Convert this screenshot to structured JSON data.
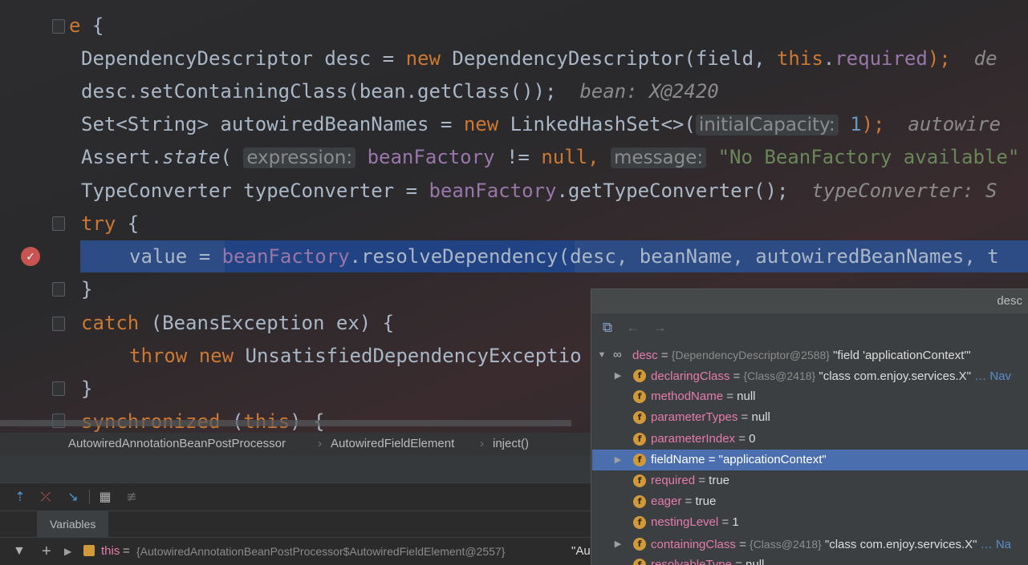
{
  "editor": {
    "lines": [
      {
        "segs": [
          {
            "t": "e",
            "c": "kw"
          },
          {
            "t": " {"
          }
        ]
      },
      {
        "segs": [
          {
            "t": "DependencyDescriptor desc = "
          },
          {
            "t": "new",
            "c": "kw"
          },
          {
            "t": " DependencyDescriptor(field, "
          },
          {
            "t": "this",
            "c": "kw"
          },
          {
            "t": "."
          },
          {
            "t": "required",
            "c": "fld"
          },
          {
            "t": ");",
            "c": "kw"
          },
          {
            "t": "  de",
            "c": "gray"
          }
        ]
      },
      {
        "segs": [
          {
            "t": "desc.setContainingClass(bean.getClass());",
            "c": ""
          },
          {
            "t": "  bean: X@2420",
            "c": "gray"
          }
        ]
      },
      {
        "segs": [
          {
            "t": "Set<String> autowiredBeanNames = "
          },
          {
            "t": "new",
            "c": "kw"
          },
          {
            "t": " LinkedHashSet<>("
          },
          {
            "t": "initialCapacity:",
            "c": "hint"
          },
          {
            "t": " "
          },
          {
            "t": "1",
            "c": "num"
          },
          {
            "t": ");",
            "c": "kw"
          },
          {
            "t": "  autowire",
            "c": "gray"
          }
        ]
      },
      {
        "segs": [
          {
            "t": "Assert."
          },
          {
            "t": "state",
            "c": "ital"
          },
          {
            "t": "( "
          },
          {
            "t": "expression:",
            "c": "hint"
          },
          {
            "t": " "
          },
          {
            "t": "beanFactory",
            "c": "fld"
          },
          {
            "t": " != "
          },
          {
            "t": "null",
            "c": "kw"
          },
          {
            "t": ", ",
            "c": "kw"
          },
          {
            "t": "message:",
            "c": "hint"
          },
          {
            "t": " "
          },
          {
            "t": "\"No BeanFactory available\"",
            "c": "str"
          }
        ]
      },
      {
        "segs": [
          {
            "t": "TypeConverter typeConverter = "
          },
          {
            "t": "beanFactory",
            "c": "fld"
          },
          {
            "t": ".getTypeConverter();"
          },
          {
            "t": "  typeConverter: S",
            "c": "gray"
          }
        ]
      },
      {
        "segs": [
          {
            "t": "try",
            "c": "kw"
          },
          {
            "t": " {"
          }
        ]
      },
      {
        "segs": [
          {
            "t": "value = "
          },
          {
            "t": "beanFactory",
            "c": "fld"
          },
          {
            "t": ".resolveDependency(desc, beanName, autowiredBeanNames, t"
          }
        ]
      },
      {
        "segs": [
          {
            "t": "}"
          }
        ]
      },
      {
        "segs": [
          {
            "t": "catch",
            "c": "kw"
          },
          {
            "t": " (BeansException ex) {"
          }
        ]
      },
      {
        "segs": [
          {
            "t": "throw new",
            "c": "kw"
          },
          {
            "t": " UnsatisfiedDependencyExceptio"
          }
        ]
      },
      {
        "segs": [
          {
            "t": "}"
          }
        ]
      },
      {
        "segs": [
          {
            "t": "synchronized",
            "c": "kw"
          },
          {
            "t": " ("
          },
          {
            "t": "this",
            "c": "kw"
          },
          {
            "t": ") {"
          }
        ]
      }
    ]
  },
  "breadcrumb": {
    "items": [
      "AutowiredAnnotationBeanPostProcessor",
      "AutowiredFieldElement",
      "inject()"
    ],
    "sep": "›"
  },
  "debugger": {
    "tab_label": "Variables",
    "this_row": {
      "name": "this",
      "eq": " = ",
      "type": "{AutowiredAnnotationBeanPostProcessor$AutowiredFieldElement@2557}",
      "value": " \"Au"
    }
  },
  "popup": {
    "title": "desc",
    "root": {
      "name": "desc",
      "eq": " = ",
      "type": "{DependencyDescriptor@2588}",
      "value": " \"field 'applicationContext'\""
    },
    "children": [
      {
        "name": "declaringClass",
        "eq": " = ",
        "type": "{Class@2418}",
        "value": " \"class com.enjoy.services.X\"",
        "extra": " … Nav",
        "expandable": true
      },
      {
        "name": "methodName",
        "eq": " = ",
        "type": "",
        "value": "null"
      },
      {
        "name": "parameterTypes",
        "eq": " = ",
        "type": "",
        "value": "null"
      },
      {
        "name": "parameterIndex",
        "eq": " = ",
        "type": "",
        "value": "0"
      },
      {
        "name": "fieldName",
        "eq": " = ",
        "type": "",
        "value": "\"applicationContext\"",
        "expandable": true,
        "selected": true
      },
      {
        "name": "required",
        "eq": " = ",
        "type": "",
        "value": "true"
      },
      {
        "name": "eager",
        "eq": " = ",
        "type": "",
        "value": "true"
      },
      {
        "name": "nestingLevel",
        "eq": " = ",
        "type": "",
        "value": "1"
      },
      {
        "name": "containingClass",
        "eq": " = ",
        "type": "{Class@2418}",
        "value": " \"class com.enjoy.services.X\"",
        "extra": " … Na",
        "expandable": true
      },
      {
        "name": "resolvableType",
        "eq": " = ",
        "type": "",
        "value": "null"
      }
    ]
  },
  "colors": {
    "keyword": "#cc7832",
    "field": "#9876aa",
    "string": "#6a8759",
    "number": "#6897bb",
    "selection": "#4b6eaf",
    "exec_line": "#2d4b85",
    "breakpoint": "#c75450"
  }
}
